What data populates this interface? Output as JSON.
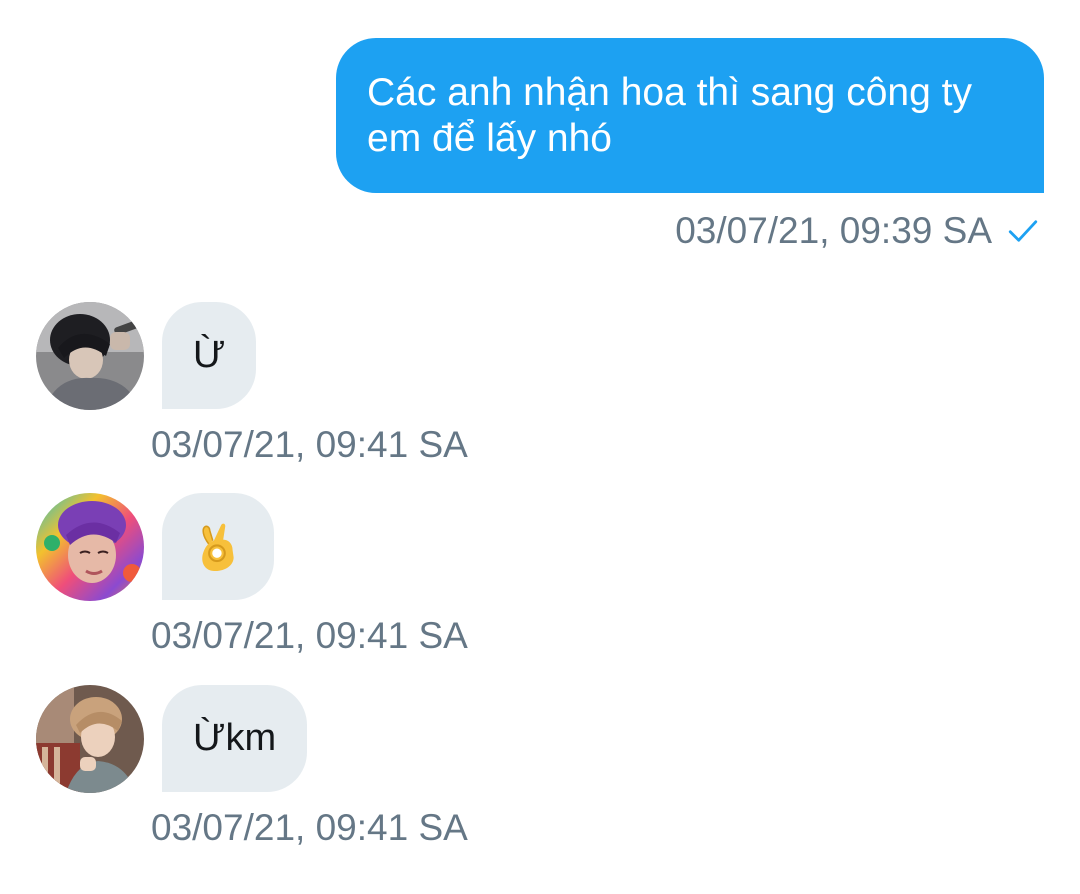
{
  "outgoing": {
    "text": "Các anh nhận hoa thì sang công ty\nem để lấy nhó",
    "timestamp": "03/07/21, 09:39 SA",
    "status_icon": "check-icon"
  },
  "incoming": [
    {
      "avatar": "avatar-dark-hair-person",
      "text": "Ừ",
      "timestamp": "03/07/21, 09:41 SA"
    },
    {
      "avatar": "avatar-purple-hair-person",
      "text": "👌",
      "timestamp": "03/07/21, 09:41 SA"
    },
    {
      "avatar": "avatar-light-hair-person",
      "text": "Ừkm",
      "timestamp": "03/07/21, 09:41 SA"
    }
  ],
  "colors": {
    "accent": "#1da1f2",
    "incoming_bubble": "#e6ecf0",
    "meta_text": "#657786",
    "message_text": "#14171a"
  }
}
